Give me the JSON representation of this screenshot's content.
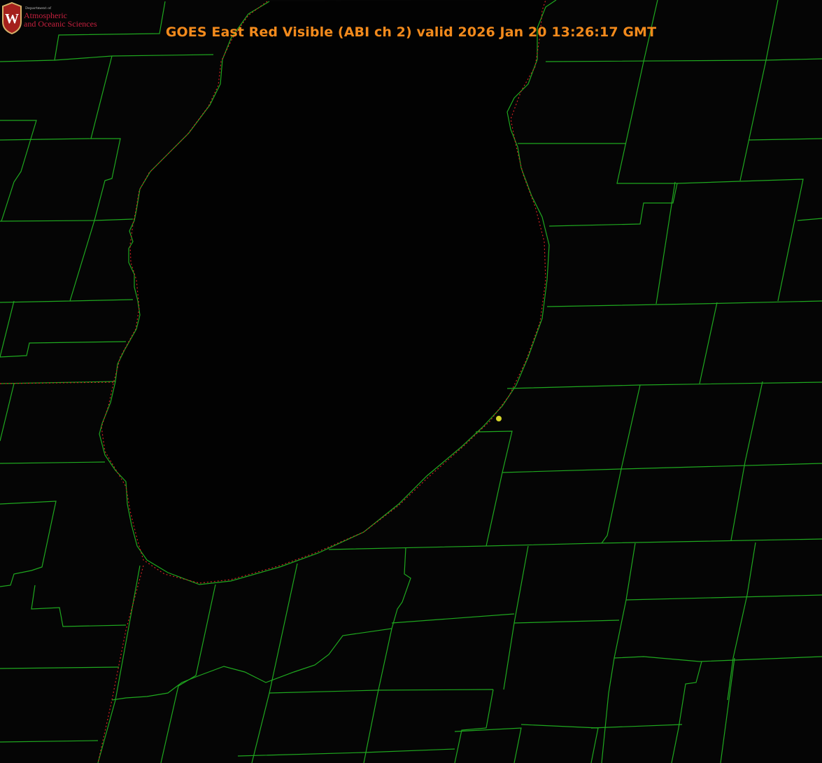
{
  "title": "GOES East Red Visible (ABI ch 2) valid 2026 Jan 20 13:26:17 GMT",
  "logo": {
    "department": "Department of",
    "line1": "Atmospheric",
    "line2": "and Oceanic Sciences",
    "crest_letter": "W"
  },
  "colors": {
    "background": "#050505",
    "lake": "#020202",
    "county_lines": "#1fa81f",
    "state_line": "#cc2222",
    "title": "#f28a1c",
    "marker": "#d6d62a",
    "logo_text": "#c5203e"
  },
  "marker": {
    "label": "station-dot"
  }
}
